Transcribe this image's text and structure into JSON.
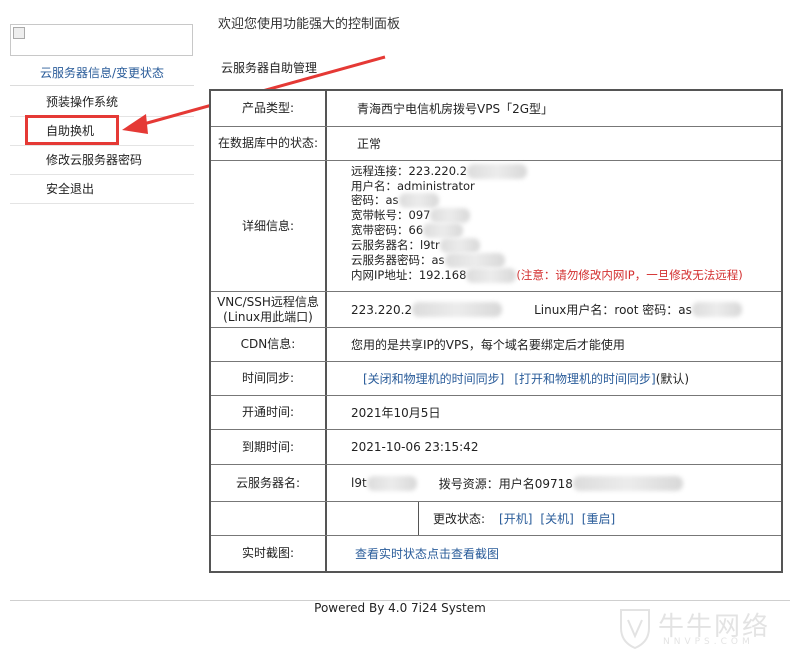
{
  "header": {
    "welcome": "欢迎您使用功能强大的控制面板",
    "subtitle": "云服务器自助管理"
  },
  "sidebar": {
    "title": "云服务器信息/变更状态",
    "items": [
      {
        "label": "预装操作系统"
      },
      {
        "label": "自助换机"
      },
      {
        "label": "修改云服务器密码"
      },
      {
        "label": "安全退出"
      }
    ]
  },
  "table": {
    "product_label": "产品类型:",
    "product_value": "青海西宁电信机房拨号VPS「2G型」",
    "db_status_label": "在数据库中的状态:",
    "db_status_value": "正常",
    "detail_label": "详细信息:",
    "detail": {
      "remote": "远程连接：223.220.2",
      "username": "用户名：administrator",
      "password": "密码：as",
      "broadband_account": "宽带帐号：097",
      "broadband_password": "宽带密码：66",
      "server_name": "云服务器名：l9tr",
      "server_password": "云服务器密码：as",
      "lan_ip": "内网IP地址：192.168",
      "lan_ip_warning": "(注意：请勿修改内网IP，一旦修改无法远程)"
    },
    "vnc_label": "VNC/SSH远程信息(Linux用此端口)",
    "vnc_value": "223.220.2",
    "vnc_linux": "Linux用户名：root 密码：as",
    "cdn_label": "CDN信息:",
    "cdn_value": "您用的是共享IP的VPS，每个域名要绑定后才能使用",
    "time_sync_label": "时间同步:",
    "time_sync_off": "[关闭和物理机的时间同步]",
    "time_sync_on": "[打开和物理机的时间同步]",
    "time_sync_default": "(默认)",
    "open_time_label": "开通时间:",
    "open_time_value": "2021年10月5日",
    "expire_label": "到期时间:",
    "expire_value": "2021-10-06 23:15:42",
    "server_name_label": "云服务器名:",
    "server_name_value": "l9t",
    "dial_resource": "拨号资源：用户名09718",
    "change_status_label": "更改状态:",
    "power_on": "[开机]",
    "power_off": "[关机]",
    "restart": "[重启]",
    "screenshot_label": "实时截图:",
    "screenshot_link": "查看实时状态点击查看截图"
  },
  "footer": {
    "powered": "Powered By 4.0 7i24 System",
    "watermark": "牛牛网络",
    "watermark_sub": "NNVPS.COM"
  },
  "colors": {
    "link": "#2a5c9a",
    "annotation_red": "#e53935",
    "warning_red": "#d32f2f"
  }
}
